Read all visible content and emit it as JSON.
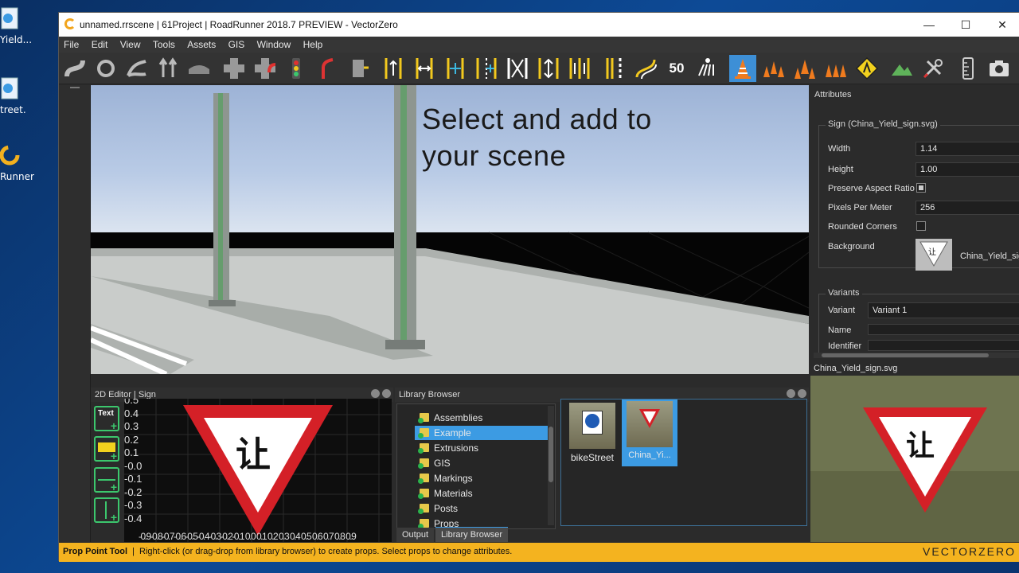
{
  "desktop": {
    "icons": [
      {
        "label": "Yield..."
      },
      {
        "label": "treet."
      },
      {
        "label": "Runner"
      }
    ]
  },
  "window": {
    "title": "unnamed.rrscene | 61Project | RoadRunner 2018.7 PREVIEW - VectorZero",
    "controls": {
      "minimize": "—",
      "maximize": "☐",
      "close": "✕"
    }
  },
  "menu": [
    "File",
    "Edit",
    "View",
    "Tools",
    "Assets",
    "GIS",
    "Window",
    "Help"
  ],
  "toolbar": {
    "active_tool": "prop-point-tool",
    "tools": [
      "road-plan-tool",
      "junction-tool",
      "road-construction-tool",
      "lane-carving-tool",
      "surface-tool",
      "junction-corner-tool",
      "corner-tool",
      "signal-tool",
      "maneuver-tool",
      "crosswalk-tool",
      "lane-tool",
      "lane-width-tool",
      "lane-add-tool",
      "lane-form-tool",
      "lane-marking-tool",
      "lane-carve-tool",
      "lane-split-tool",
      "marking-point-tool",
      "marking-curve-tool",
      "speed-limit-tool",
      "crosswalk-stop-tool",
      "prop-point-tool",
      "prop-curve-tool",
      "prop-polygon-tool",
      "prop-set-tool",
      "sign-tool",
      "terrain-tool",
      "custom-tool",
      "measure-tool",
      "snapshot-tool"
    ],
    "speed_label": "50"
  },
  "viewport": {
    "overlay_text_line1": "Select and add to",
    "overlay_text_line2": "your scene"
  },
  "editor2d": {
    "title": "2D Editor | Sign",
    "tools": {
      "text": "Text"
    },
    "y_ticks": [
      "0.5",
      "0.4",
      "0.3",
      "0.2",
      "0.1",
      "-0.0",
      "-0.1",
      "-0.2",
      "-0.3",
      "-0.4"
    ],
    "x_ticks": "-0.9-0.8-0.7-0.6-0.5-0.4-0.3-0.2-0.1 0.0 0.1 0.2 0.3 0.4 0.5 0.6 0.7 0.8 0.9",
    "sign_glyph": "让"
  },
  "library": {
    "title": "Library Browser",
    "tree": [
      {
        "label": "Assemblies"
      },
      {
        "label": "Example",
        "selected": true
      },
      {
        "label": "Extrusions"
      },
      {
        "label": "GIS"
      },
      {
        "label": "Markings"
      },
      {
        "label": "Materials"
      },
      {
        "label": "Posts"
      },
      {
        "label": "Props"
      }
    ],
    "assets": [
      {
        "label": "bikeStreet",
        "selected": false
      },
      {
        "label": "China_Yi...",
        "selected": true
      }
    ],
    "tabs": [
      {
        "label": "Output",
        "active": false
      },
      {
        "label": "Library Browser",
        "active": true
      }
    ]
  },
  "attributes": {
    "title": "Attributes",
    "sign_group": "Sign (China_Yield_sign.svg)",
    "width_label": "Width",
    "width_value": "1.14",
    "height_label": "Height",
    "height_value": "1.00",
    "preserve_label": "Preserve Aspect Ratio",
    "preserve_checked": true,
    "ppm_label": "Pixels Per Meter",
    "ppm_value": "256",
    "rounded_label": "Rounded Corners",
    "rounded_checked": false,
    "background_label": "Background",
    "background_file": "China_Yield_sign",
    "variants_group": "Variants",
    "variant_label": "Variant",
    "variant_value": "Variant 1",
    "name_label": "Name",
    "identifier_label": "Identifier"
  },
  "preview": {
    "title": "China_Yield_sign.svg"
  },
  "status": {
    "tool": "Prop Point Tool",
    "message": "Right-click (or drag-drop from library browser) to create props. Select props to change attributes.",
    "brand": "VECTORZERO"
  },
  "colors": {
    "accent": "#3c9be3",
    "status_bar": "#f4b31f",
    "sign_red": "#d42027"
  }
}
